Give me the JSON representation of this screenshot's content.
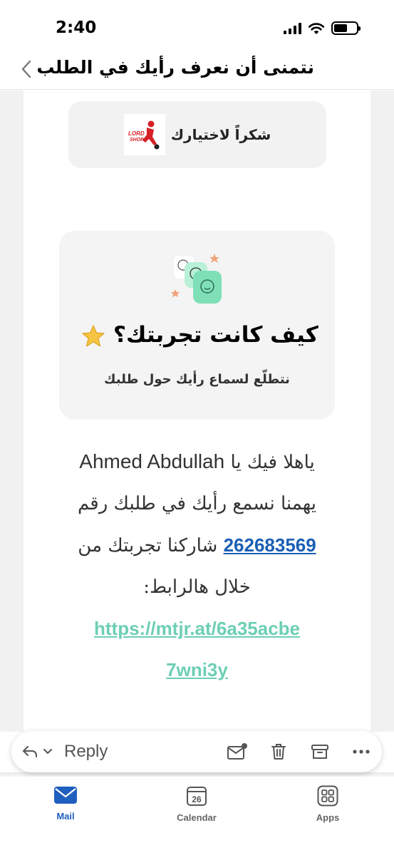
{
  "status": {
    "time": "2:40"
  },
  "nav": {
    "title": "نتمنى أن نعرف رأيك في الطلب"
  },
  "email": {
    "thanks_text": "شكراً لاختيارك",
    "logo_text_1": "LORD",
    "logo_text_2": "SHOP",
    "experience_title": "كيف كانت تجربتك؟",
    "experience_subtitle": "نتطلّع لسماع رأيك حول طلبك",
    "greeting_prefix": "ياهلا فيك يا ",
    "customer_name": "Ahmed Abdullah",
    "middle_text": " يهمنا نسمع رأيك في طلبك رقم ",
    "order_number": "262683569",
    "after_order_text": " شاركنا تجربتك من خلال هالرابط: ",
    "feedback_url": "https://mtjr.at/6a35acbe7wni3y"
  },
  "action_bar": {
    "reply_label": "Reply"
  },
  "tabs": [
    {
      "label": "Mail",
      "active": true
    },
    {
      "label": "Calendar",
      "active": false,
      "day": "26"
    },
    {
      "label": "Apps",
      "active": false
    }
  ],
  "colors": {
    "accent": "#1f5fbf",
    "link_green": "#6ccfb3",
    "order_link": "#1a5fb4",
    "logo_red": "#d62027"
  }
}
